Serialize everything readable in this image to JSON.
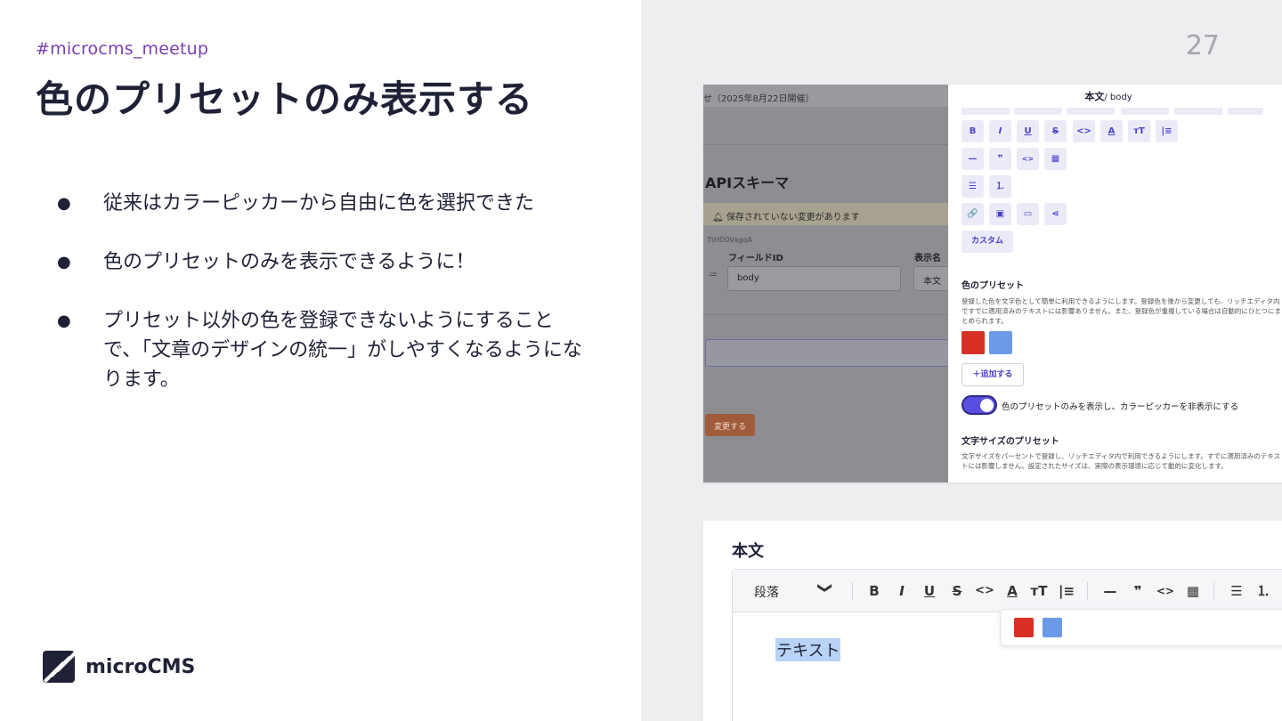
{
  "slide": {
    "hashtag": "#microcms_meetup",
    "title": "色のプリセットのみ表示する",
    "bullets": [
      "従来はカラーピッカーから自由に色を選択できた",
      "色のプリセットのみを表示できるように！",
      "プリセット以外の色を登録できないようにすることで、「文章のデザインの統一」がしやすくなるようになります。"
    ],
    "bullet_glyph": "●",
    "logo_text": "microCMS",
    "page_number": "27"
  },
  "screenshot1": {
    "topbar_text": "せ（2025年8月22日開催）",
    "heading": "APIスキーマ",
    "warning": "保存されていない変更があります",
    "warning_icon": "bell-icon",
    "field_id_small": "TtHD0VagqA",
    "field_id_label": "フィールドID",
    "display_name_label": "表示名",
    "field_id_value": "body",
    "display_name_value": "本文",
    "drag_handle": "=",
    "change_button": "変更する",
    "panel_title": "本文",
    "panel_title_sub": "/ body",
    "toolbar_row1": [
      "B",
      "I",
      "U",
      "S",
      "<>",
      "A",
      "тT",
      "|≡"
    ],
    "toolbar_row2": [
      "—",
      "❞",
      "<>",
      "▦"
    ],
    "toolbar_row3": [
      "☰",
      "⒈"
    ],
    "toolbar_row4": [
      "🔗",
      "▣",
      "▭",
      "⋖"
    ],
    "custom_button": "カスタム",
    "color_preset_title": "色のプリセット",
    "color_preset_desc": "登録した色を文字色として簡単に利用できるようにします。登録色を後から変更しても、リッチエディタ内ですでに適用済みのテキストには影響ありません。また、登録色が重複している場合は自動的にひとつにまとめられます。",
    "swatches": [
      "#d93025",
      "#6d9ae8"
    ],
    "add_button": "＋追加する",
    "toggle_label": "色のプリセットのみを表示し、カラーピッカーを非表示にする",
    "toggle_on": true,
    "font_size_title": "文字サイズのプリセット",
    "font_size_desc": "文字サイズをパーセントで登録し、リッチエディタ内で利用できるようにします。すでに適用済みのテキストには影響しません。設定されたサイズは、実際の表示環境に応じて動的に変化します。"
  },
  "screenshot2": {
    "title": "本文",
    "paragraph_select": "段落",
    "chevron": "❯",
    "tools": [
      "B",
      "I",
      "U",
      "S",
      "<>",
      "A",
      "тT",
      "|≡",
      "—",
      "❞",
      "<>",
      "▦",
      "☰",
      "⒈"
    ],
    "text": "テキスト",
    "swatches": [
      "#d93025",
      "#6d9ae8"
    ]
  },
  "colors": {
    "hashtag": "#7b3fb0",
    "accent": "#4a43c7",
    "toggle": "#5a4ee0"
  }
}
